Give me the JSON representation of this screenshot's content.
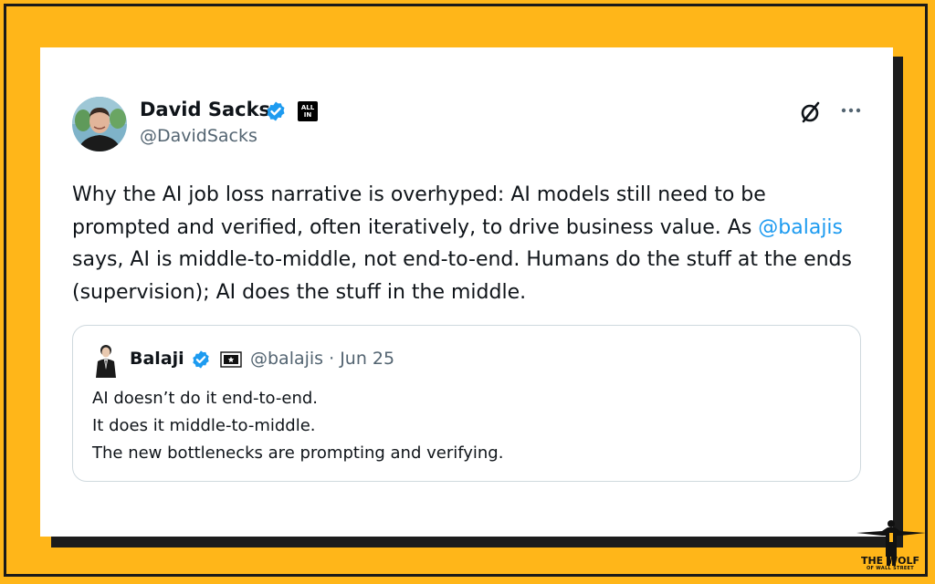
{
  "author": {
    "name": "David Sacks",
    "handle": "@DavidSacks",
    "badge_text": "ALL IN"
  },
  "tweet": {
    "text_before": "Why the AI job loss narrative is overhyped: AI models still need to be prompted and verified, often iteratively, to drive business value. As ",
    "mention": "@balajis",
    "text_after": " says, AI is middle-to-middle, not end-to-end. Humans do the stuff at the ends (supervision); AI does the stuff in the middle."
  },
  "quote": {
    "name": "Balaji",
    "meta": "@balajis · Jun 25",
    "lines": [
      "AI doesn’t do it end-to-end.",
      "It does it middle-to-middle.",
      "The new bottlenecks are prompting and verifying."
    ]
  },
  "watermark": {
    "line1": "THE WOLF",
    "line2": "OF WALL STREET"
  },
  "icons": {
    "verified": "verified-badge-icon",
    "grok": "grok-icon",
    "more": "more-icon"
  },
  "colors": {
    "background": "#ffb619",
    "mention": "#1d9bf0",
    "verified": "#1d9bf0",
    "text": "#0f1419",
    "muted": "#536471"
  }
}
